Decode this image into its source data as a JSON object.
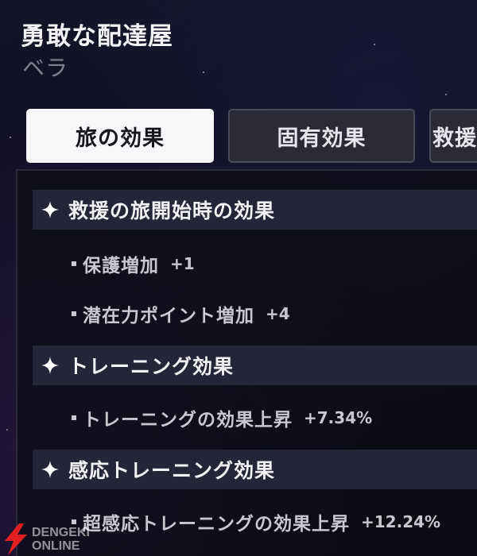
{
  "character": {
    "title": "勇敢な配達屋",
    "name": "ベラ"
  },
  "tabs": [
    {
      "label": "旅の効果",
      "active": true
    },
    {
      "label": "固有効果",
      "active": false
    },
    {
      "label": "救援",
      "active": false
    }
  ],
  "sections": [
    {
      "icon": "sparkle-icon",
      "header": "救援の旅開始時の効果",
      "items": [
        {
          "name": "保護増加",
          "value": "+1"
        },
        {
          "name": "潜在力ポイント増加",
          "value": "+4"
        }
      ]
    },
    {
      "icon": "sparkle-icon",
      "header": "トレーニング効果",
      "items": [
        {
          "name": "トレーニングの効果上昇",
          "value": "+7.34%"
        }
      ]
    },
    {
      "icon": "sparkle-icon",
      "header": "感応トレーニング効果",
      "items": [
        {
          "name": "超感応トレーニングの効果上昇",
          "value": "+12.24%"
        }
      ]
    }
  ],
  "watermark": {
    "line1": "DENGEKI",
    "line2": "ONLINE",
    "icon": "lightning-bolt-icon",
    "color": "#e02020"
  },
  "colors": {
    "active_tab_bg": "#f7f7fa",
    "inactive_tab_bg": "#2a2a38",
    "section_header_bg": "#25253a"
  }
}
